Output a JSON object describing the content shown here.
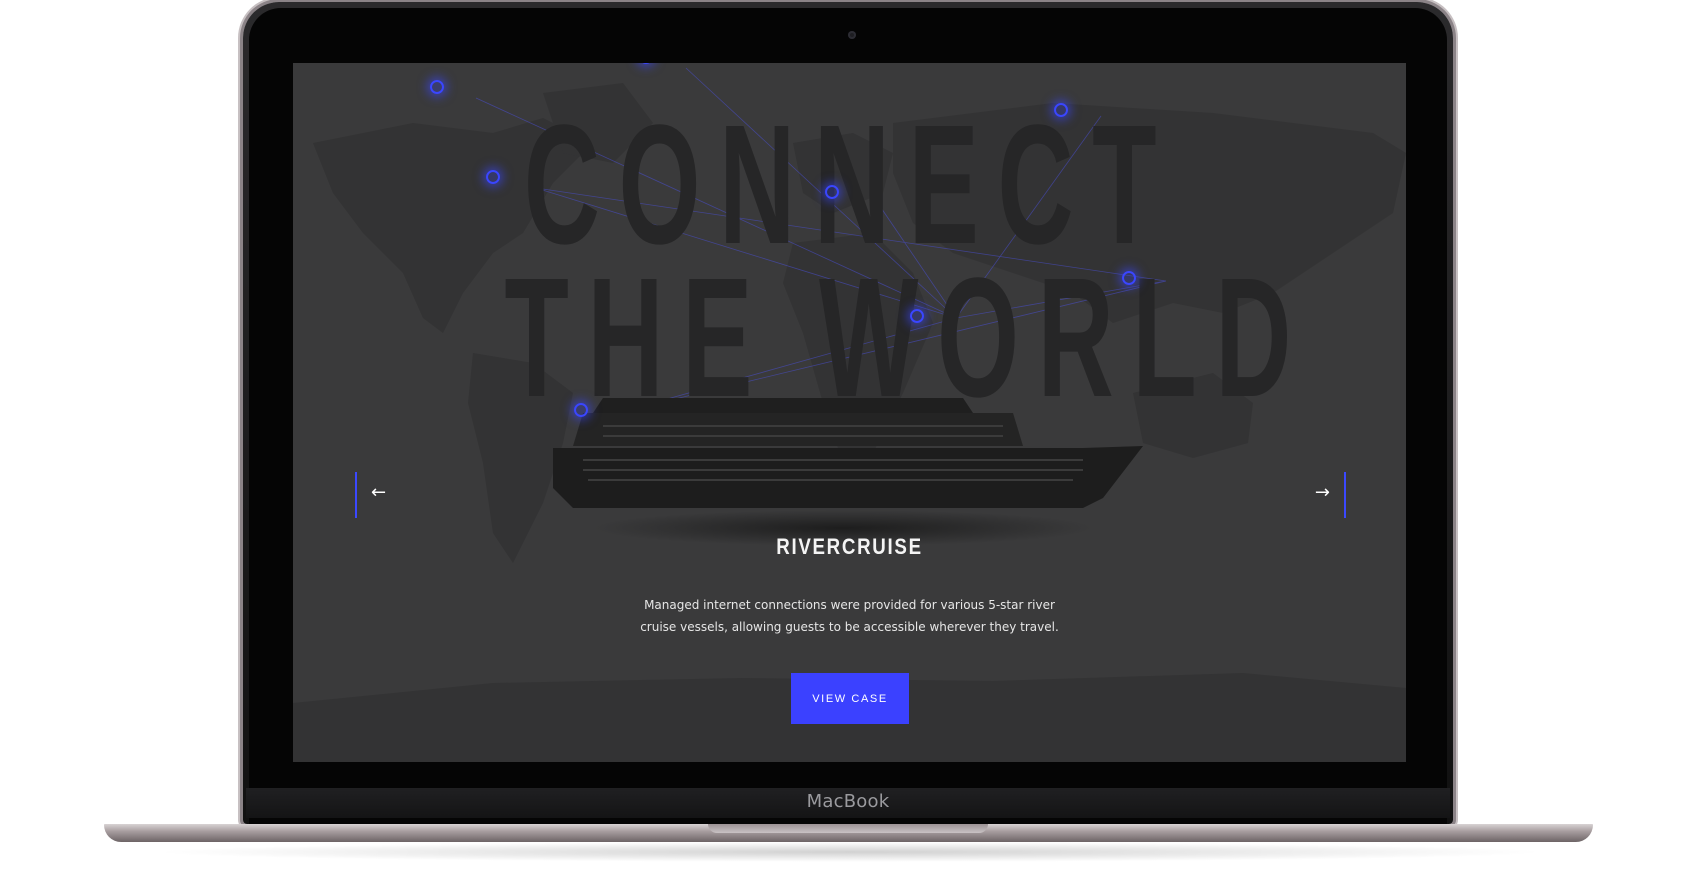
{
  "device": {
    "brand_label": "MacBook"
  },
  "hero": {
    "headline_line1": "CONNECT",
    "headline_line2": "THE WORLD"
  },
  "slide": {
    "title": "RIVERCRUISE",
    "description": "Managed internet connections were provided for various 5-star river cruise vessels, allowing guests to be accessible wherever they travel.",
    "cta_label": "VIEW CASE",
    "prev_glyph": "←",
    "next_glyph": "→"
  },
  "icons": {
    "prev": "arrow-left-icon",
    "next": "arrow-right-icon"
  },
  "colors": {
    "accent": "#3b41ff",
    "screen_bg": "#3a3a3b",
    "headline": "#262627",
    "node_glow": "#3a46ff"
  }
}
